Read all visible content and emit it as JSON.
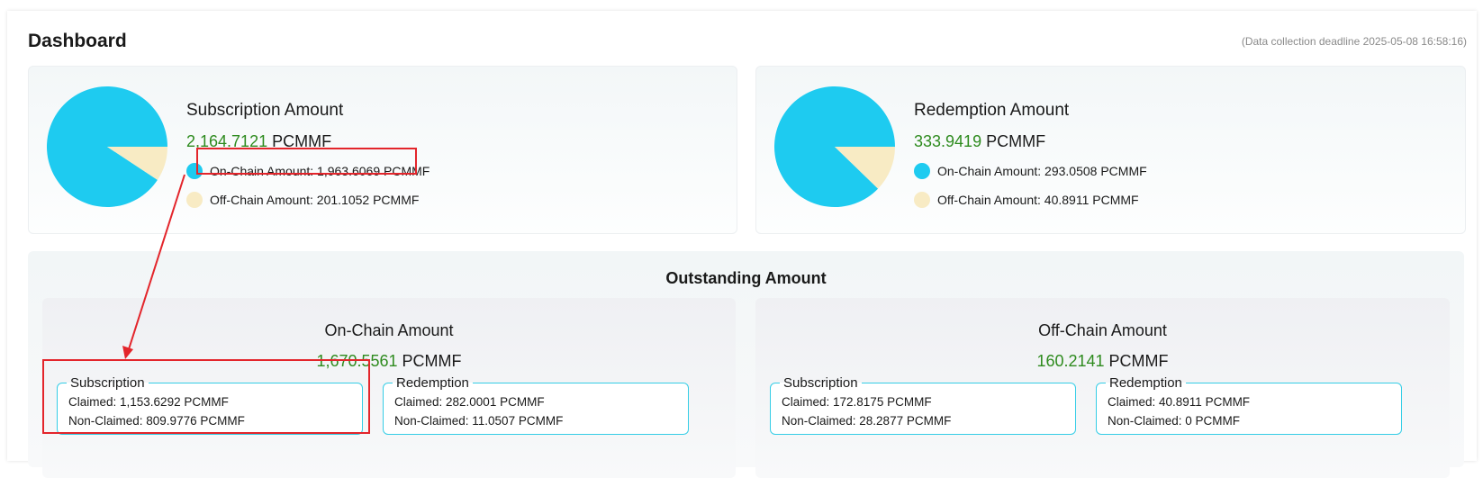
{
  "header": {
    "title": "Dashboard",
    "deadline": "(Data collection deadline 2025-05-08 16:58:16)"
  },
  "subscription": {
    "title": "Subscription Amount",
    "total_value": "2,164.7121",
    "unit": "PCMMF",
    "on_chain_label": "On-Chain Amount: 1,963.6069 PCMMF",
    "off_chain_label": "Off-Chain Amount: 201.1052 PCMMF",
    "on_chain_value": 1963.6069,
    "off_chain_value": 201.1052
  },
  "redemption": {
    "title": "Redemption Amount",
    "total_value": "333.9419",
    "unit": "PCMMF",
    "on_chain_label": "On-Chain Amount: 293.0508 PCMMF",
    "off_chain_label": "Off-Chain Amount: 40.8911 PCMMF",
    "on_chain_value": 293.0508,
    "off_chain_value": 40.8911
  },
  "outstanding": {
    "title": "Outstanding Amount",
    "on_chain": {
      "title": "On-Chain Amount",
      "total_value": "1,670.5561",
      "unit": "PCMMF",
      "subscription": {
        "legend": "Subscription",
        "claimed": "Claimed: 1,153.6292 PCMMF",
        "non_claimed": "Non-Claimed: 809.9776 PCMMF"
      },
      "redemption": {
        "legend": "Redemption",
        "claimed": "Claimed: 282.0001 PCMMF",
        "non_claimed": "Non-Claimed: 11.0507 PCMMF"
      }
    },
    "off_chain": {
      "title": "Off-Chain Amount",
      "total_value": "160.2141",
      "unit": "PCMMF",
      "subscription": {
        "legend": "Subscription",
        "claimed": "Claimed: 172.8175 PCMMF",
        "non_claimed": "Non-Claimed: 28.2877 PCMMF"
      },
      "redemption": {
        "legend": "Redemption",
        "claimed": "Claimed: 40.8911 PCMMF",
        "non_claimed": "Non-Claimed: 0 PCMMF"
      }
    }
  },
  "colors": {
    "on_chain": "#1ecbf0",
    "off_chain": "#f8ebc4",
    "value_green": "#2e8b1e",
    "annotation_red": "#e3252b",
    "box_border": "#35cde6"
  }
}
